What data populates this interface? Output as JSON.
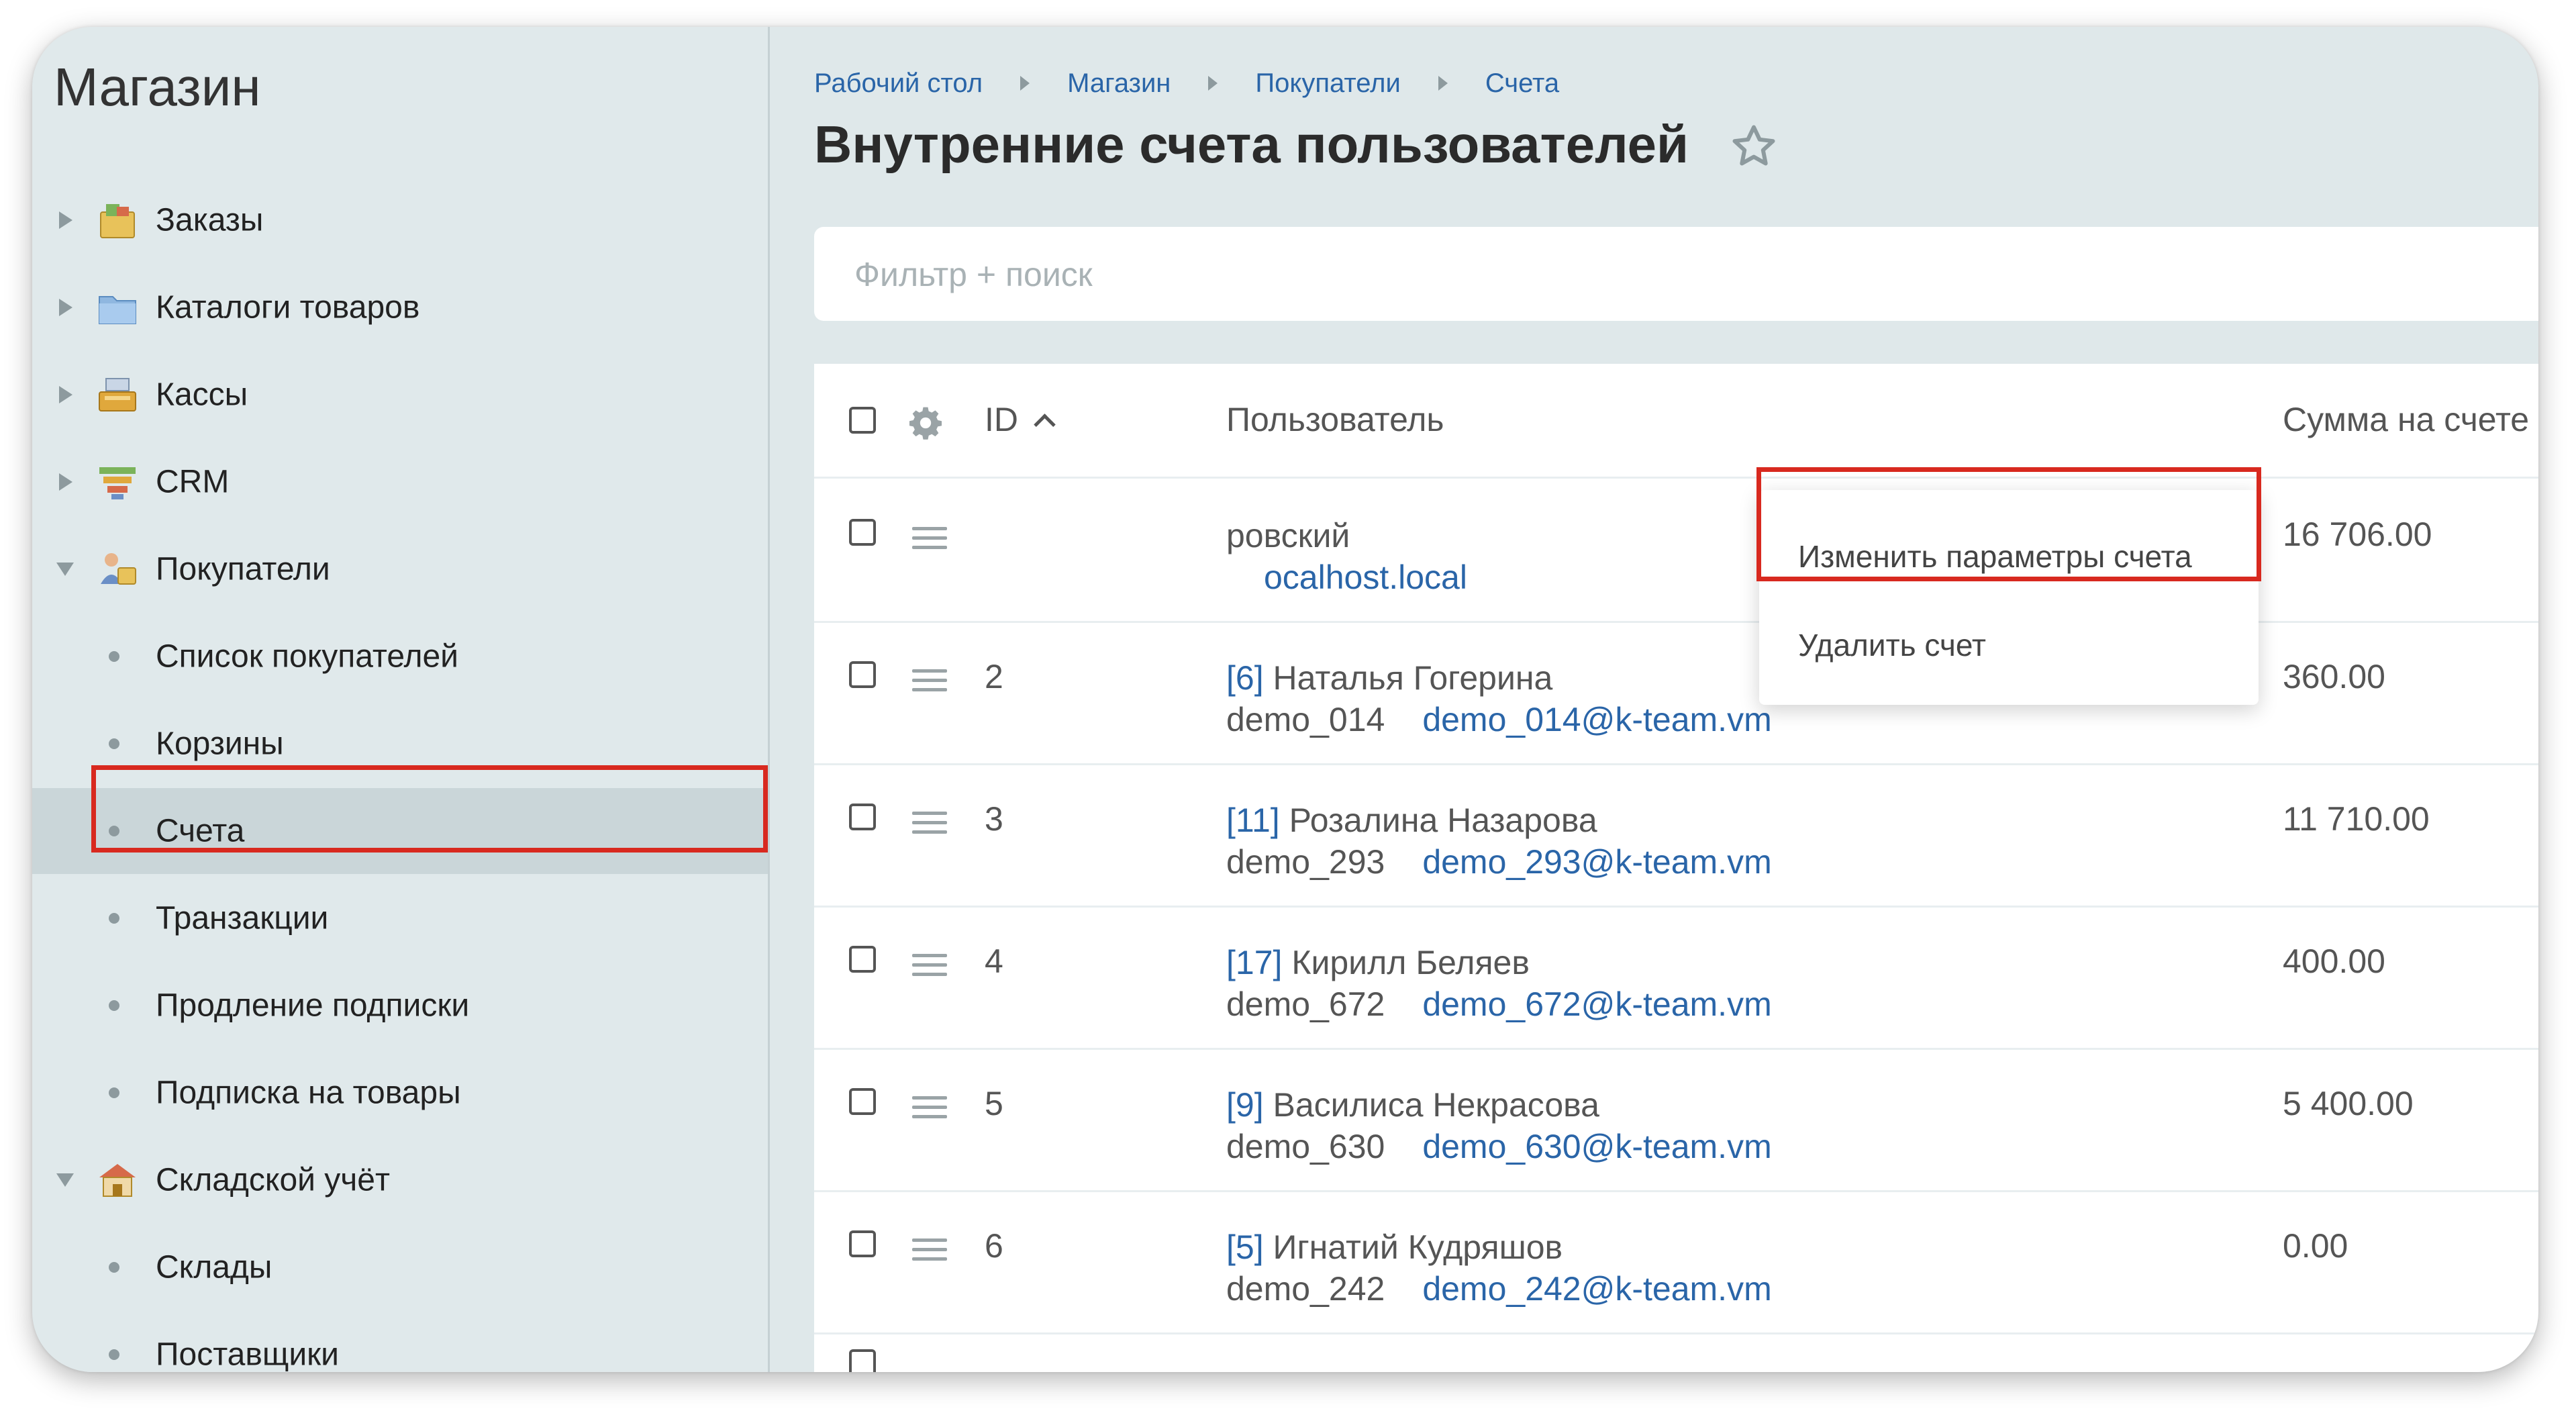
{
  "sidebar": {
    "title": "Магазин",
    "items": [
      {
        "label": "Заказы",
        "icon": "orders-icon",
        "expanded": false
      },
      {
        "label": "Каталоги товаров",
        "icon": "folder-icon",
        "expanded": false
      },
      {
        "label": "Кассы",
        "icon": "cash-register-icon",
        "expanded": false
      },
      {
        "label": "CRM",
        "icon": "crm-funnel-icon",
        "expanded": false
      },
      {
        "label": "Покупатели",
        "icon": "customers-icon",
        "expanded": true
      },
      {
        "label": "Складской учёт",
        "icon": "warehouse-icon",
        "expanded": true
      }
    ],
    "customers_sub": [
      {
        "label": "Список покупателей"
      },
      {
        "label": "Корзины"
      },
      {
        "label": "Счета",
        "active": true
      },
      {
        "label": "Транзакции"
      },
      {
        "label": "Продление подписки"
      },
      {
        "label": "Подписка на товары"
      }
    ],
    "warehouse_sub": [
      {
        "label": "Склады"
      },
      {
        "label": "Поставщики"
      }
    ]
  },
  "breadcrumb": [
    "Рабочий стол",
    "Магазин",
    "Покупатели",
    "Счета"
  ],
  "page_title": "Внутренние счета пользователей",
  "filter": {
    "placeholder": "Фильтр + поиск"
  },
  "grid": {
    "columns": {
      "id": "ID",
      "user": "Пользователь",
      "sum": "Сумма на счете"
    },
    "rows": [
      {
        "id": "",
        "user_id": "",
        "name": "ровский",
        "login": "",
        "email": "ocalhost.local",
        "sum": "16 706.00"
      },
      {
        "id": "2",
        "user_id": "[6]",
        "name": "Наталья Гогерина",
        "login": "demo_014",
        "email": "demo_014@k-team.vm",
        "sum": "360.00"
      },
      {
        "id": "3",
        "user_id": "[11]",
        "name": "Розалина Назарова",
        "login": "demo_293",
        "email": "demo_293@k-team.vm",
        "sum": "11 710.00"
      },
      {
        "id": "4",
        "user_id": "[17]",
        "name": "Кирилл Беляев",
        "login": "demo_672",
        "email": "demo_672@k-team.vm",
        "sum": "400.00"
      },
      {
        "id": "5",
        "user_id": "[9]",
        "name": "Василиса Некрасова",
        "login": "demo_630",
        "email": "demo_630@k-team.vm",
        "sum": "5 400.00"
      },
      {
        "id": "6",
        "user_id": "[5]",
        "name": "Игнатий Кудряшов",
        "login": "demo_242",
        "email": "demo_242@k-team.vm",
        "sum": "0.00"
      }
    ]
  },
  "context_menu": {
    "items": [
      "Изменить параметры счета",
      "Удалить счет"
    ]
  },
  "colors": {
    "highlight": "#d8291f",
    "link": "#2a65a8",
    "sidebar_bg": "#e0e9eb"
  }
}
